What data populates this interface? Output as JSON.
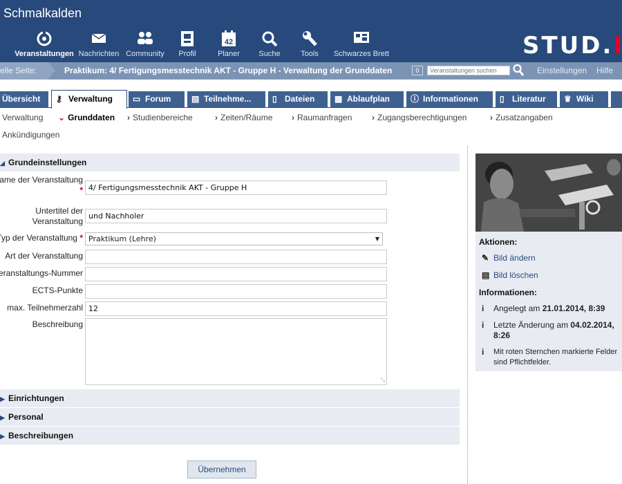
{
  "header": {
    "title": "Schmalkalden",
    "nav": [
      {
        "label": "Veranstaltungen",
        "icon": "courses-icon",
        "active": true
      },
      {
        "label": "Nachrichten",
        "icon": "mail-icon"
      },
      {
        "label": "Community",
        "icon": "community-icon"
      },
      {
        "label": "Profil",
        "icon": "profile-icon"
      },
      {
        "label": "Planer",
        "icon": "calendar-icon",
        "day": "42"
      },
      {
        "label": "Suche",
        "icon": "search-icon"
      },
      {
        "label": "Tools",
        "icon": "tools-icon"
      },
      {
        "label": "Schwarzes Brett",
        "icon": "board-icon"
      }
    ],
    "logo_main": "STUD.",
    "logo_accent": "I"
  },
  "breadcrumb": {
    "label": "elle Seite:",
    "text": "Praktikum: 4/ Fertigungsmesstechnik AKT - Gruppe H - Verwaltung der Grunddaten",
    "count": "0",
    "search_placeholder": "Veranstaltungen suchen",
    "links": [
      "Einstellungen",
      "Hilfe"
    ]
  },
  "tabs": [
    {
      "label": "Übersicht",
      "icon": "overview-icon"
    },
    {
      "label": "Verwaltung",
      "icon": "admin-icon",
      "active": true
    },
    {
      "label": "Forum",
      "icon": "forum-icon"
    },
    {
      "label": "Teilnehme...",
      "icon": "participants-icon"
    },
    {
      "label": "Dateien",
      "icon": "files-icon"
    },
    {
      "label": "Ablaufplan",
      "icon": "schedule-icon"
    },
    {
      "label": "Informationen",
      "icon": "info-icon"
    },
    {
      "label": "Literatur",
      "icon": "literature-icon"
    },
    {
      "label": "Wiki",
      "icon": "wiki-icon"
    }
  ],
  "subnav": [
    {
      "label": "Verwaltung"
    },
    {
      "label": "Grunddaten",
      "active": true
    },
    {
      "label": "Studienbereiche"
    },
    {
      "label": "Zeiten/Räume"
    },
    {
      "label": "Raumanfragen"
    },
    {
      "label": "Zugangsberechtigungen"
    },
    {
      "label": "Zusatzangaben"
    },
    {
      "label": "Ankündigungen"
    }
  ],
  "form": {
    "section_main": "Grundeinstellungen",
    "labels": {
      "name_line1": "Name der Veranstaltung",
      "subtitle_line1": "Untertitel der",
      "subtitle_line2": "Veranstaltung",
      "type": "Typ der Veranstaltung",
      "kind": "Art der Veranstaltung",
      "number": "Veranstaltungs-Nummer",
      "ects": "ECTS-Punkte",
      "max": "max. Teilnehmerzahl",
      "description": "Beschreibung"
    },
    "values": {
      "name": "4/ Fertigungsmesstechnik AKT - Gruppe H",
      "subtitle": "und Nachholer",
      "type": "Praktikum (Lehre)",
      "kind": "",
      "number": "",
      "ects": "",
      "max": "12",
      "description": ""
    },
    "required_mark": "*",
    "sections": [
      "Einrichtungen",
      "Personal",
      "Beschreibungen"
    ],
    "submit_label": "Übernehmen"
  },
  "sidebar": {
    "actions_title": "Aktionen:",
    "actions": [
      {
        "label": "Bild ändern",
        "icon": "edit-icon"
      },
      {
        "label": "Bild löschen",
        "icon": "trash-icon"
      }
    ],
    "info_title": "Informationen:",
    "created_prefix": "Angelegt am",
    "created_value": "21.01.2014, 8:39",
    "modified_prefix": "Letzte Änderung am",
    "modified_value": "04.02.2014,",
    "modified_value_time": "8:26",
    "note": "Mit roten Sternchen markierte Felder sind Pflichtfelder."
  }
}
